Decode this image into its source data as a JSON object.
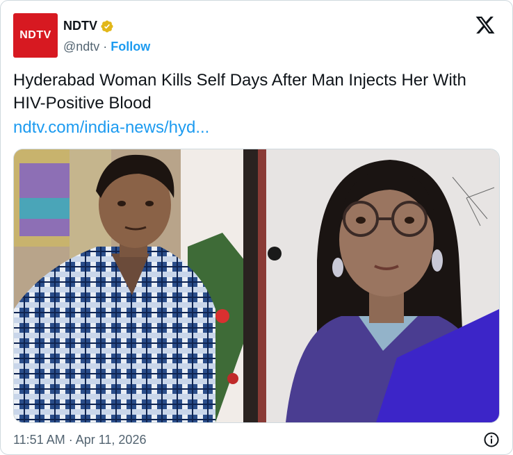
{
  "account": {
    "avatar_text": "NDTV",
    "name": "NDTV",
    "handle": "@ndtv",
    "separator": " · ",
    "follow_label": "Follow"
  },
  "tweet": {
    "text": "Hyderabad Woman Kills Self Days After Man Injects Her With HIV-Positive Blood",
    "link_text": "ndtv.com/india-news/hyd..."
  },
  "footer": {
    "timestamp": "11:51 AM · Apr 11, 2026"
  },
  "colors": {
    "brand_red": "#d71921",
    "link_blue": "#1d9bf0",
    "verified_gold": "#e2b719",
    "secondary_text": "#536471"
  },
  "icons": {
    "verified": "verified-badge-icon",
    "platform": "x-logo-icon",
    "info": "info-icon"
  }
}
